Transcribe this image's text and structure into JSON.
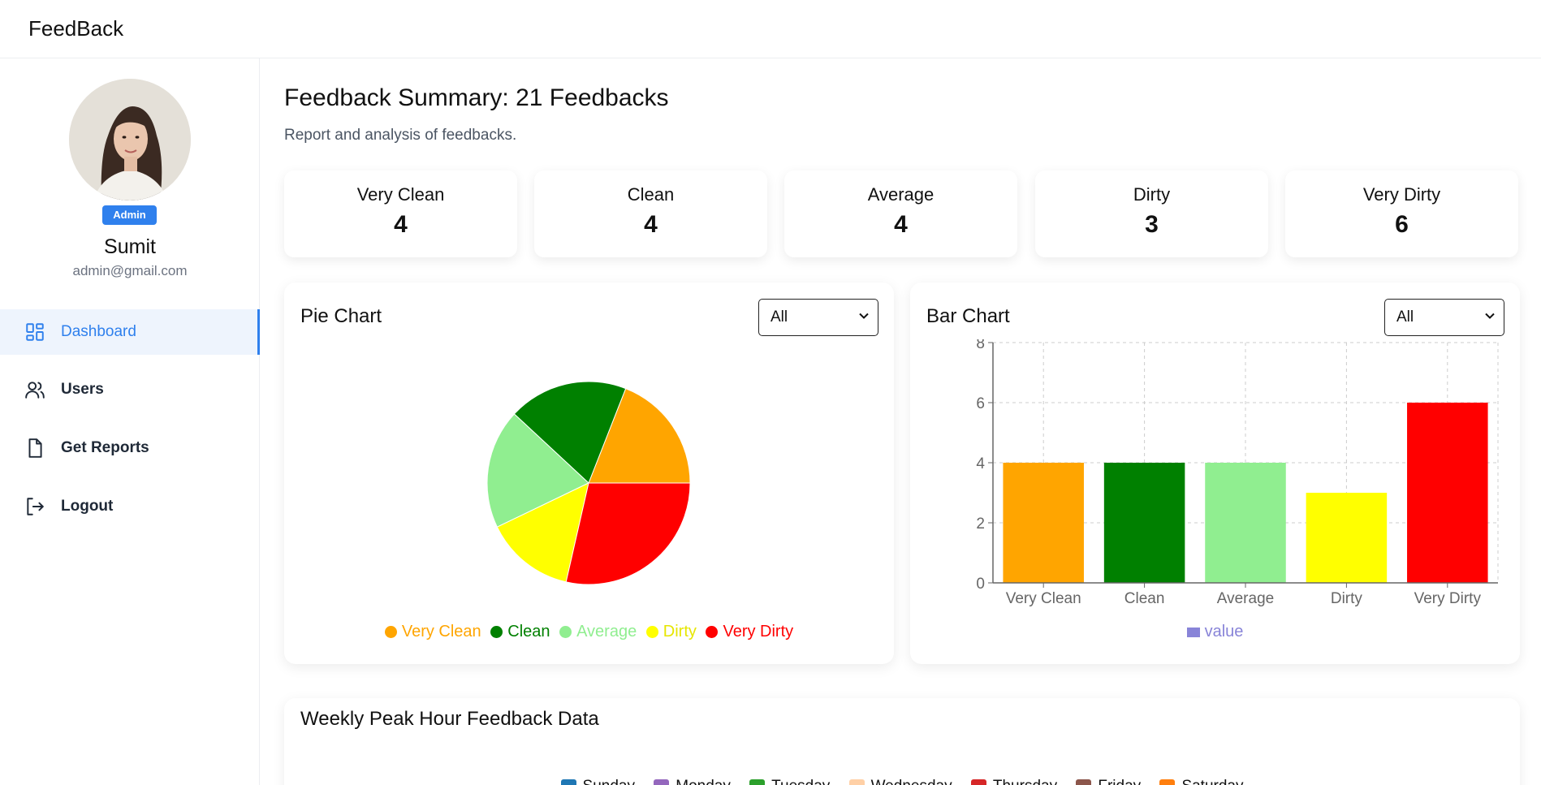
{
  "app": {
    "brand": "FeedBack"
  },
  "user": {
    "role": "Admin",
    "name": "Sumit",
    "email": "admin@gmail.com"
  },
  "nav": [
    {
      "label": "Dashboard",
      "icon": "dashboard-grid-icon",
      "active": true
    },
    {
      "label": "Users",
      "icon": "users-icon",
      "active": false
    },
    {
      "label": "Get Reports",
      "icon": "document-icon",
      "active": false
    },
    {
      "label": "Logout",
      "icon": "logout-icon",
      "active": false
    }
  ],
  "header": {
    "title": "Feedback Summary: 21 Feedbacks",
    "subtitle": "Report and analysis of feedbacks."
  },
  "stats": [
    {
      "label": "Very Clean",
      "value": "4"
    },
    {
      "label": "Clean",
      "value": "4"
    },
    {
      "label": "Average",
      "value": "4"
    },
    {
      "label": "Dirty",
      "value": "3"
    },
    {
      "label": "Very Dirty",
      "value": "6"
    }
  ],
  "pie_panel": {
    "title": "Pie Chart",
    "filter_value": "All"
  },
  "bar_panel": {
    "title": "Bar Chart",
    "filter_value": "All"
  },
  "weekly_panel": {
    "title": "Weekly Peak Hour Feedback Data",
    "legend": [
      {
        "label": "Sunday",
        "color": "#1f77b4"
      },
      {
        "label": "Monday",
        "color": "#9467bd"
      },
      {
        "label": "Tuesday",
        "color": "#2ca02c"
      },
      {
        "label": "Wednesday",
        "color": "#ffd0a6"
      },
      {
        "label": "Thursday",
        "color": "#d62728"
      },
      {
        "label": "Friday",
        "color": "#8c564b"
      },
      {
        "label": "Saturday",
        "color": "#ff7f0e"
      }
    ]
  },
  "colors": {
    "accent": "#2f80ed",
    "very_clean": "#ffa500",
    "clean": "#008000",
    "average": "#90ee90",
    "dirty": "#ffff00",
    "very_dirty": "#ff0000",
    "bar_legend": "#8884d8"
  },
  "chart_data": [
    {
      "type": "pie",
      "title": "Pie Chart",
      "categories": [
        "Very Clean",
        "Clean",
        "Average",
        "Dirty",
        "Very Dirty"
      ],
      "values": [
        4,
        4,
        4,
        3,
        6
      ],
      "colors": [
        "#ffa500",
        "#008000",
        "#90ee90",
        "#ffff00",
        "#ff0000"
      ],
      "legend": "bottom"
    },
    {
      "type": "bar",
      "title": "Bar Chart",
      "categories": [
        "Very Clean",
        "Clean",
        "Average",
        "Dirty",
        "Very Dirty"
      ],
      "series": [
        {
          "name": "value",
          "values": [
            4,
            4,
            4,
            3,
            6
          ]
        }
      ],
      "colors": [
        "#ffa500",
        "#008000",
        "#90ee90",
        "#ffff00",
        "#ff0000"
      ],
      "ylim": [
        0,
        8
      ],
      "yticks": [
        0,
        2,
        4,
        6,
        8
      ],
      "grid": true,
      "legend": "bottom"
    }
  ]
}
